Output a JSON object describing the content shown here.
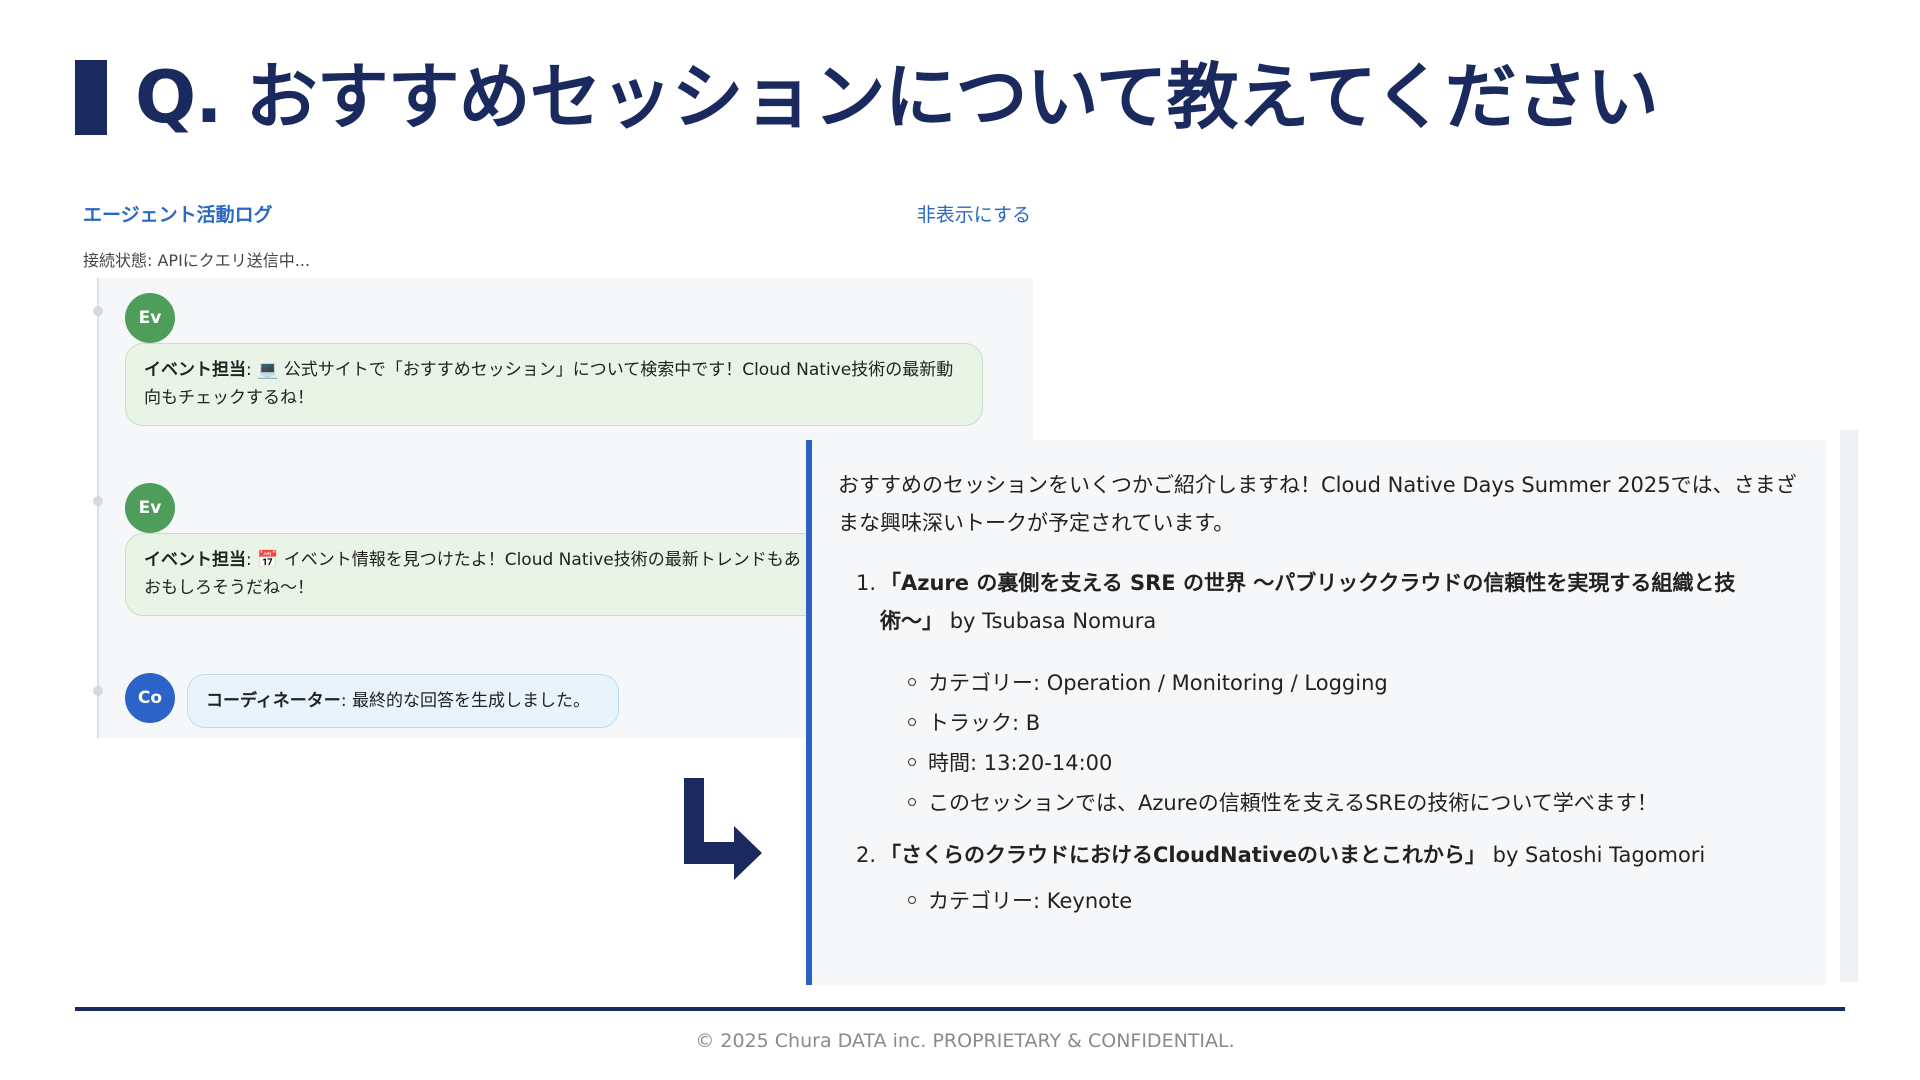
{
  "slide": {
    "title": "Q. おすすめセッションについて教えてください"
  },
  "agent_log": {
    "title": "エージェント活動ログ",
    "hide_label": "非表示にする",
    "connection_status": "接続状態: APIにクエリ送信中...",
    "entries": [
      {
        "avatar": "Ev",
        "speaker": "イベント担当",
        "icon": "💻",
        "line1": "公式サイトで「おすすめセッション」について検索中です！Cloud Native技術の最新動",
        "line2": "向もチェックするね！"
      },
      {
        "avatar": "Ev",
        "speaker": "イベント担当",
        "icon": "📅",
        "line1": "イベント情報を見つけたよ！Cloud Native技術の最新トレンドもあ",
        "line2": "おもしろそうだね〜！"
      },
      {
        "avatar": "Co",
        "speaker": "コーディネーター",
        "text": "最終的な回答を生成しました。"
      }
    ]
  },
  "response": {
    "intro_line1": "おすすめのセッションをいくつかご紹介しますね！Cloud Native Days Summer 2025では、さまざ",
    "intro_line2": "まな興味深いトークが予定されています。",
    "items": [
      {
        "number": "1.",
        "title_line1": "「Azure の裏側を支える SRE の世界 〜パブリッククラウドの信頼性を実現する組織と技",
        "title_line2": "術〜」",
        "speaker": "by Tsubasa Nomura",
        "details": [
          "カテゴリー: Operation / Monitoring / Logging",
          "トラック: B",
          "時間: 13:20-14:00",
          "このセッションでは、Azureの信頼性を支えるSREの技術について学べます！"
        ]
      },
      {
        "number": "2.",
        "title_line1": "「さくらのクラウドにおけるCloudNativeのいまとこれから」",
        "speaker": "by Satoshi Tagomori",
        "details": [
          "カテゴリー: Keynote"
        ]
      }
    ]
  },
  "footer": {
    "copyright": "© 2025 Chura DATA inc. PROPRIETARY & CONFIDENTIAL."
  },
  "colors": {
    "navy": "#1b2a5e",
    "accent_blue": "#2e62c0",
    "event_green": "#4f9d5b",
    "coordinator_blue": "#2b63c8"
  }
}
